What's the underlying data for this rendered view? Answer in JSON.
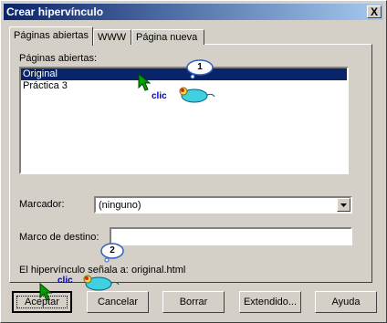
{
  "window": {
    "title": "Crear hipervínculo",
    "close_glyph": "X"
  },
  "tabs": [
    {
      "label": "Páginas abiertas",
      "active": true
    },
    {
      "label": "WWW",
      "active": false
    },
    {
      "label": "Página nueva",
      "active": false
    }
  ],
  "open_pages": {
    "label": "Páginas abiertas:",
    "items": [
      {
        "label": "Original",
        "selected": true
      },
      {
        "label": "Práctica 3",
        "selected": false
      }
    ]
  },
  "marcador": {
    "label": "Marcador:",
    "value": "(ninguno)"
  },
  "marco": {
    "label": "Marco de destino:",
    "value": ""
  },
  "link_target": {
    "label": "El hipervínculo señala a:",
    "value": "original.html"
  },
  "buttons": {
    "accept": "Aceptar",
    "cancel": "Cancelar",
    "delete": "Borrar",
    "extended": "Extendido...",
    "help": "Ayuda"
  },
  "annotations": {
    "step1": {
      "number": "1",
      "text": "clic"
    },
    "step2": {
      "number": "2",
      "text": "clic"
    }
  },
  "colors": {
    "title_bar": "#0a246a",
    "selection": "#0a246a",
    "clic_text": "#0000c0",
    "cursor": "#00a000",
    "mouse_body": "#40d0e0"
  }
}
